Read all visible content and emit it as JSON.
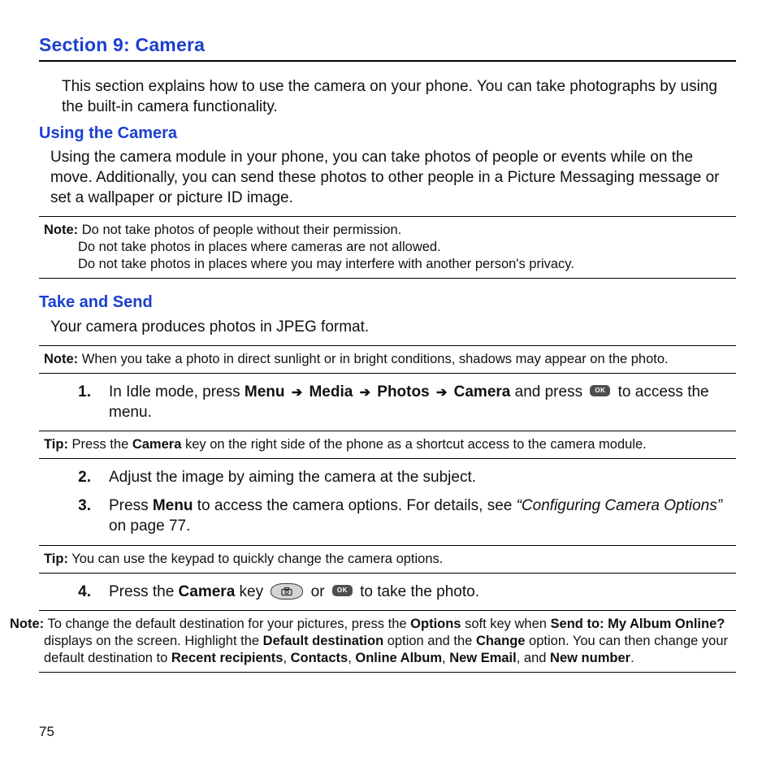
{
  "pageNumber": "75",
  "sectionTitle": "Section 9: Camera",
  "intro": "This section explains how to use the camera on your phone. You can take photographs by using the built-in camera functionality.",
  "usingCamera": {
    "heading": "Using the Camera",
    "body": "Using the camera module in your phone, you can take photos of people or events while on the move. Additionally, you can send these photos to other people in a Picture Messaging message or set a wallpaper or picture ID image."
  },
  "note1": {
    "label": "Note:",
    "line1": "Do not take photos of people without their permission.",
    "line2": "Do not take photos in places where cameras are not allowed.",
    "line3": "Do not take photos in places where you may interfere with another person's privacy."
  },
  "takeSend": {
    "heading": "Take and Send",
    "body": "Your camera produces photos in JPEG format."
  },
  "note2": {
    "label": "Note:",
    "text": "When you take a photo in direct sunlight or in bright conditions, shadows may appear on the photo."
  },
  "step1": {
    "num": "1.",
    "pre": "In Idle mode, press ",
    "kMenu": "Menu",
    "kMedia": "Media",
    "kPhotos": "Photos",
    "kCamera": "Camera",
    "mid": " and press ",
    "post": " to access the menu."
  },
  "tip1": {
    "label": "Tip:",
    "pre": "Press the ",
    "kCamera": "Camera",
    "post": " key on the right side of the phone as a shortcut access to the camera module."
  },
  "step2": {
    "num": "2.",
    "text": "Adjust the image by aiming the camera at the subject."
  },
  "step3": {
    "num": "3.",
    "pre": "Press ",
    "kMenu": "Menu",
    "mid": " to access the camera options. For details, see ",
    "ref": "“Configuring Camera Options”",
    "post": " on page 77."
  },
  "tip2": {
    "label": "Tip:",
    "text": "You can use the keypad to quickly change the camera options."
  },
  "step4": {
    "num": "4.",
    "pre": "Press the ",
    "kCamera": "Camera",
    "mid": " key ",
    "or": " or ",
    "post": " to take the photo."
  },
  "note3": {
    "label": "Note:",
    "pre": "To change the default destination for your pictures, press the ",
    "kOptions": "Options",
    "mid1": " soft key when ",
    "kSendTo": "Send to: My Album Online?",
    "mid2": " displays on the screen. Highlight the ",
    "kDefault": "Default destination",
    "mid3": " option and the ",
    "kChange": "Change",
    "mid4": " option. You can then change your default destination to ",
    "kRecent": "Recent recipients",
    "c1": ", ",
    "kContacts": "Contacts",
    "kOnline": "Online Album",
    "kEmail": "New Email",
    "cAnd": ", and ",
    "kNumber": "New number",
    "period": "."
  },
  "okLabel": "OK"
}
